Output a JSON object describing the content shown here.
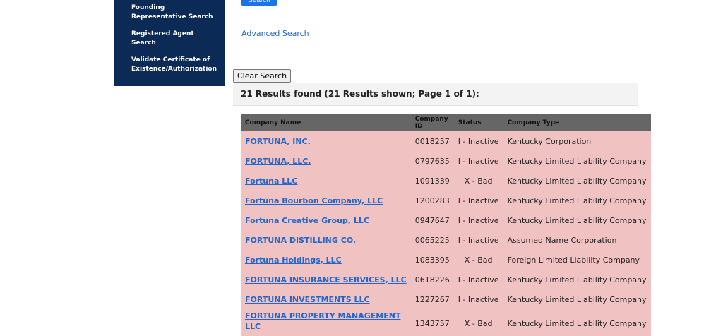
{
  "sidebar": {
    "items": [
      {
        "label": "Founding Representative Search"
      },
      {
        "label": "Registered Agent Search"
      },
      {
        "label": "Validate Certificate of Existence/Authorization"
      }
    ]
  },
  "search": {
    "button_label": "Search",
    "advanced_link": "Advanced Search",
    "clear_label": "Clear Search"
  },
  "results": {
    "summary": "21 Results found (21 Results shown; Page 1 of 1):",
    "columns": [
      "Company Name",
      "Company ID",
      "Status",
      "Company Type"
    ],
    "rows": [
      {
        "name": "FORTUNA, INC.",
        "id": "0018257",
        "status": "I - Inactive",
        "type": "Kentucky Corporation"
      },
      {
        "name": "FORTUNA, LLC.",
        "id": "0797635",
        "status": "I - Inactive",
        "type": "Kentucky Limited Liability Company"
      },
      {
        "name": "Fortuna LLC",
        "id": "1091339",
        "status": "X - Bad",
        "type": "Kentucky Limited Liability Company"
      },
      {
        "name": "Fortuna Bourbon Company, LLC",
        "id": "1200283",
        "status": "I - Inactive",
        "type": "Kentucky Limited Liability Company"
      },
      {
        "name": "Fortuna Creative Group, LLC",
        "id": "0947647",
        "status": "I - Inactive",
        "type": "Kentucky Limited Liability Company"
      },
      {
        "name": "FORTUNA DISTILLING CO.",
        "id": "0065225",
        "status": "I - Inactive",
        "type": "Assumed Name Corporation"
      },
      {
        "name": "Fortuna Holdings, LLC",
        "id": "1083395",
        "status": "X - Bad",
        "type": "Foreign Limited Liability Company"
      },
      {
        "name": "FORTUNA INSURANCE SERVICES, LLC",
        "id": "0618226",
        "status": "I - Inactive",
        "type": "Kentucky Limited Liability Company"
      },
      {
        "name": "FORTUNA INVESTMENTS LLC",
        "id": "1227267",
        "status": "I - Inactive",
        "type": "Kentucky Limited Liability Company"
      },
      {
        "name": "FORTUNA PROPERTY MANAGEMENT LLC",
        "id": "1343757",
        "status": "X - Bad",
        "type": "Kentucky Limited Liability Company"
      }
    ]
  }
}
